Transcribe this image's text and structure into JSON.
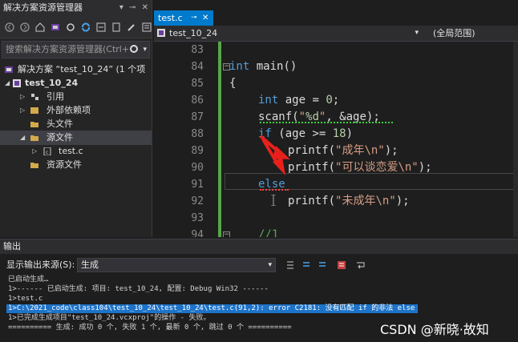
{
  "solution_explorer": {
    "title": "解决方案资源管理器",
    "search_placeholder": "搜索解决方案资源管理器(Ctrl+",
    "tree": {
      "solution": "解决方案 “test_10_24” (1 个项",
      "project": "test_10_24",
      "references": "引用",
      "external": "外部依赖项",
      "headers": "头文件",
      "sources": "源文件",
      "source_file": "test.c",
      "resources": "资源文件"
    }
  },
  "editor": {
    "tab_label": "test.c",
    "nav_left": "test_10_24",
    "nav_right": "(全局范围)",
    "line_numbers": [
      "83",
      "84",
      "85",
      "86",
      "87",
      "88",
      "89",
      "90",
      "91",
      "92",
      "93",
      "94"
    ],
    "code": {
      "l84_kw": "int",
      "l84_rest": " main()",
      "l85": "{",
      "l86_kw": "int",
      "l86_rest": " age = ",
      "l86_num": "0",
      "l86_end": ";",
      "l87_a": "scanf(",
      "l87_str1": "\"",
      "l87_fmt": "%d",
      "l87_str2": "\"",
      "l87_b": ", &age);",
      "l88_kw": "if",
      "l88_rest": " (age >= ",
      "l88_num": "18",
      "l88_end": ")",
      "l89_a": "printf(",
      "l89_str": "\"成年\\n\"",
      "l89_b": ");",
      "l90_a": "printf(",
      "l90_str": "\"可以谈恋爱\\n\"",
      "l90_b": ");",
      "l91_kw": "else",
      "l92_a": "printf(",
      "l92_str": "\"未成年\\n\"",
      "l92_b": ");",
      "l94_cmt": "//1"
    }
  },
  "output": {
    "title": "输出",
    "source_label": "显示输出来源(S):",
    "source_value": "生成",
    "lines": [
      "已启动生成…",
      "1>------ 已启动生成: 项目: test_10_24, 配置: Debug Win32 ------",
      "1>test.c",
      "1>C:\\2021_code\\class104\\test_10_24\\test_10_24\\test.c(91,2): error C2181: 没有匹配 if 的非法 else",
      "1>已完成生成项目\"test_10_24.vcxproj\"的操作 - 失败。",
      "========== 生成: 成功 0 个, 失败 1 个, 最新 0 个, 跳过 0 个 =========="
    ]
  },
  "watermark": "CSDN @新晓·故知",
  "colors": {
    "accent": "#007acc",
    "keyword": "#569cd6",
    "string": "#d69d85",
    "comment": "#57a64a",
    "annotation_arrow": "#e8201c",
    "error_highlight": "#1d73c8"
  }
}
